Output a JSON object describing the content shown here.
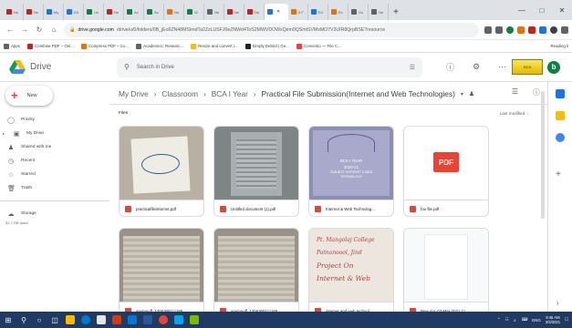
{
  "browser": {
    "tabs": [
      {
        "label": "Ne",
        "color": "#c5221f"
      },
      {
        "label": "Ne",
        "color": "#c5221f"
      },
      {
        "label": "My",
        "color": "#1a73e8"
      },
      {
        "label": "AS",
        "color": "#1a73e8"
      },
      {
        "label": "Un",
        "color": "#0b8043"
      },
      {
        "label": "Ne",
        "color": "#c5221f"
      },
      {
        "label": "Ac",
        "color": "#0b8043"
      },
      {
        "label": "Ac",
        "color": "#0b8043"
      },
      {
        "label": "Ne",
        "color": "#e37400"
      },
      {
        "label": "W",
        "color": "#0b8043"
      },
      {
        "label": "Ne",
        "color": "#5f6368"
      },
      {
        "label": "Ne",
        "color": "#c5221f"
      },
      {
        "label": "Ne",
        "color": "#c5221f"
      },
      {
        "label": "",
        "color": "#1a73e8",
        "active": true
      },
      {
        "label": "3.F",
        "color": "#e37400"
      },
      {
        "label": "Ed",
        "color": "#1a73e8"
      },
      {
        "label": "Ex",
        "color": "#e37400"
      },
      {
        "label": "Gc",
        "color": "#5f6368"
      },
      {
        "label": "Ne",
        "color": "#5f6368"
      }
    ],
    "url_host": "drive.google.com",
    "url_path": "/drive/u/0/folders/0B_jEo6ZN48MSImdTa2ZzLUSFJ0eZNWd4ToS2MWVDOWxQem0QSmtSVMxMO7V3UIR8QrpBSE?resource",
    "bookmarks": [
      {
        "label": "Apps",
        "color": "#5f6368"
      },
      {
        "label": "Combine PDF – Onl...",
        "color": "#c5221f"
      },
      {
        "label": "Compress PDF – Co...",
        "color": "#e37400"
      },
      {
        "label": "Academics: Researc...",
        "color": "#5f6368"
      },
      {
        "label": "Resize and convert i...",
        "color": "#fbbc04"
      },
      {
        "label": "Simply Debrid | Ge...",
        "color": "#202124"
      },
      {
        "label": "Convertio — File C...",
        "color": "#ea4335"
      }
    ],
    "reading_list": "Reading li"
  },
  "header": {
    "app_name": "Drive",
    "search_placeholder": "Search in Drive",
    "logo_text": "BCA"
  },
  "sidebar": {
    "new_label": "New",
    "items": [
      {
        "label": "Priority",
        "icon": "check-circle-icon"
      },
      {
        "label": "My Drive",
        "icon": "drive-icon"
      },
      {
        "label": "Shared with me",
        "icon": "people-icon"
      },
      {
        "label": "Recent",
        "icon": "clock-icon"
      },
      {
        "label": "Starred",
        "icon": "star-icon"
      },
      {
        "label": "Trash",
        "icon": "trash-icon"
      }
    ],
    "storage_label": "Storage",
    "storage_used": "32.7 GB used"
  },
  "breadcrumb": {
    "items": [
      "My Drive",
      "Classroom",
      "BCA I Year",
      "Practical File Submission(Internet and Web Technologies)"
    ]
  },
  "main": {
    "files_label": "Files",
    "sort_label": "Last modified",
    "files": [
      {
        "name": "practicalfileinternet.pdf",
        "thumb": "photo-note"
      },
      {
        "name": "Untitled document (1).pdf",
        "thumb": "photo-dark"
      },
      {
        "name": "Internet & Web Technolog...",
        "thumb": "cover-purple"
      },
      {
        "name": "foo file.pdf",
        "thumb": "pdf-badge"
      },
      {
        "name": "anutosoff_1200305111185...",
        "thumb": "photo-notebook"
      },
      {
        "name": "anutosoff_1200305111165...",
        "thumb": "photo-notebook"
      },
      {
        "name": "internet and web technol...",
        "thumb": "handwritten"
      },
      {
        "name": "New doc 03-Mar-2021 11...",
        "thumb": "blank"
      }
    ],
    "pdf_badge_text": "PDF",
    "cover_lines": [
      "BCA I YEAR",
      "2020-21",
      "SUBJECT: INTERNET & WEB",
      "TECHNOLOGY"
    ],
    "handwritten_lines": [
      "Pt. Mangolaj College",
      "Patnanoool, Jind",
      "Project On",
      "Internet & Web"
    ]
  },
  "taskbar": {
    "time": "9:46 AM",
    "date": "3/3/2021",
    "lang": "ENG"
  }
}
